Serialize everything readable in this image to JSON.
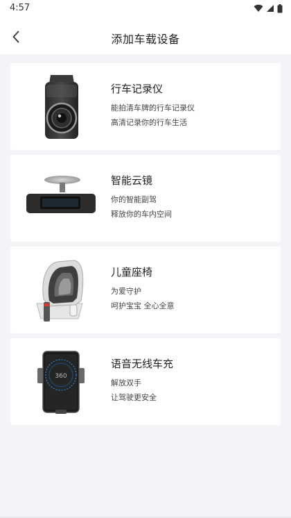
{
  "status_bar": {
    "time": "4:57"
  },
  "nav": {
    "title": "添加车载设备"
  },
  "devices": [
    {
      "title": "行车记录仪",
      "line1": "能拍清车牌的行车记录仪",
      "line2": "高清记录你的行车生活",
      "image": "dashcam"
    },
    {
      "title": "智能云镜",
      "line1": "你的智能副驾",
      "line2": "释放你的车内空间",
      "image": "smart-mirror"
    },
    {
      "title": "儿童座椅",
      "line1": "为爱守护",
      "line2": "呵护宝宝 全心全意",
      "image": "child-seat"
    },
    {
      "title": "语音无线车充",
      "line1": "解放双手",
      "line2": "让驾驶更安全",
      "image": "wireless-charger",
      "brand_text": "360"
    }
  ]
}
